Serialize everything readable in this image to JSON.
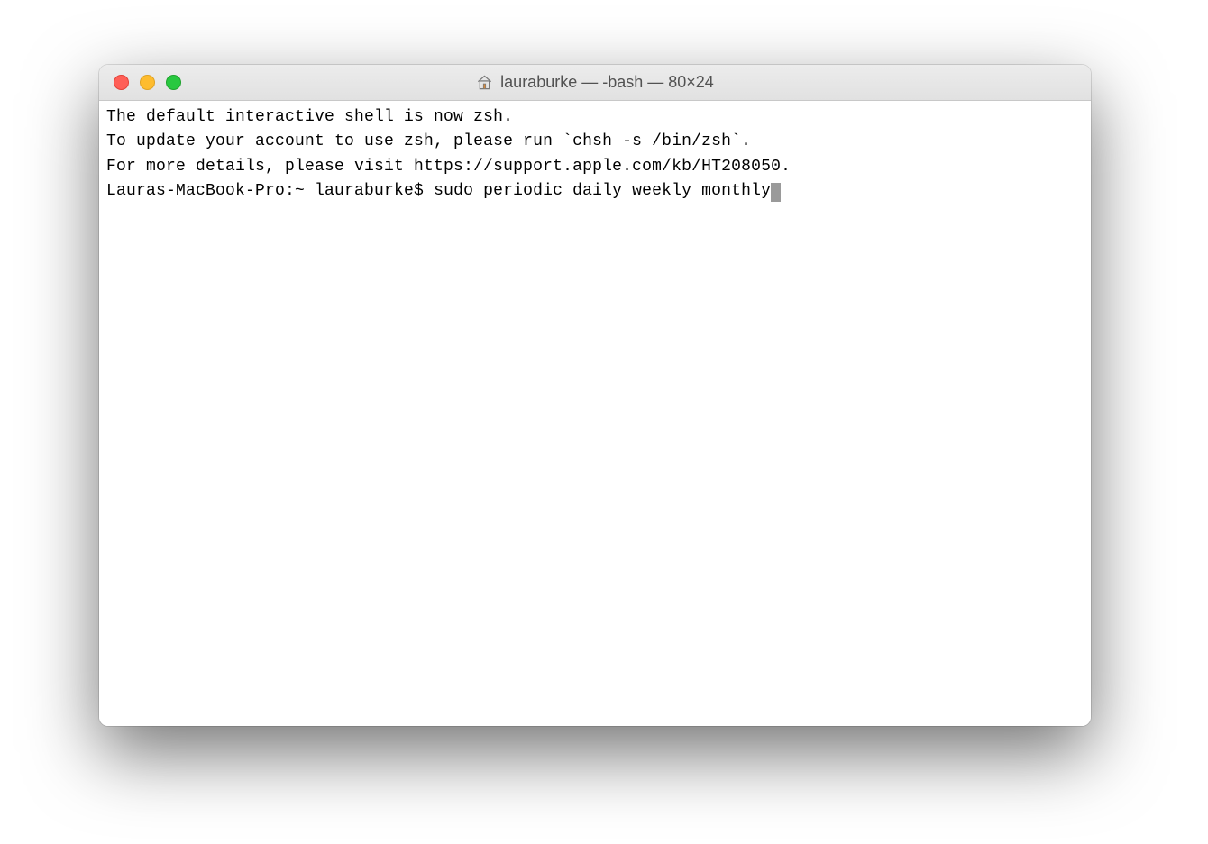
{
  "window": {
    "title": "lauraburke — -bash — 80×24"
  },
  "terminal": {
    "lines": [
      "The default interactive shell is now zsh.",
      "To update your account to use zsh, please run `chsh -s /bin/zsh`.",
      "For more details, please visit https://support.apple.com/kb/HT208050."
    ],
    "prompt": "Lauras-MacBook-Pro:~ lauraburke$ ",
    "command": "sudo periodic daily weekly monthly"
  },
  "colors": {
    "close": "#ff5f57",
    "minimize": "#febc2e",
    "maximize": "#28c840"
  }
}
